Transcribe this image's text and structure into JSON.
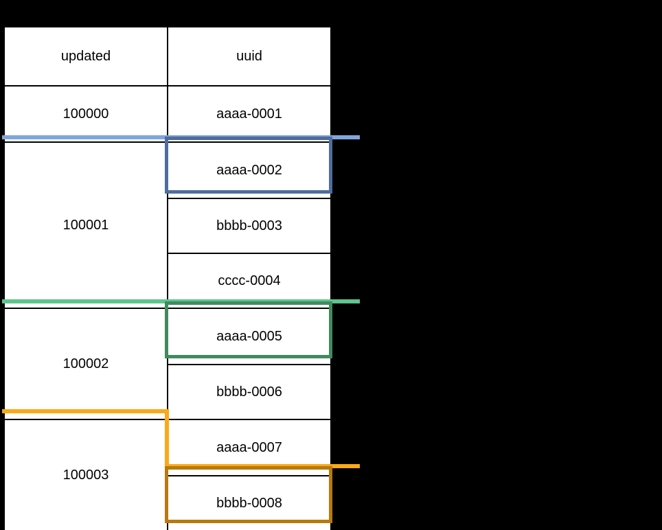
{
  "diagram": {
    "type": "table-grouping-illustration",
    "background_color": "#000000",
    "table": {
      "border_color": "#000000",
      "cell_background": "#ffffff",
      "text_color": "#000000",
      "columns": [
        "updated",
        "uuid"
      ],
      "header": {
        "updated": "updated",
        "uuid": "uuid"
      },
      "rows": [
        {
          "updated": "100000",
          "uuids": [
            "aaaa-0001"
          ]
        },
        {
          "updated": "100001",
          "uuids": [
            "aaaa-0002",
            "bbbb-0003",
            "cccc-0004"
          ]
        },
        {
          "updated": "100002",
          "uuids": [
            "aaaa-0005",
            "bbbb-0006"
          ]
        },
        {
          "updated": "100003",
          "uuids": [
            "aaaa-0007",
            "bbbb-0008"
          ]
        }
      ]
    },
    "markers": [
      {
        "name": "blue-group-marker",
        "line_color": "#7FA6DC",
        "box_color": "#4F6D9E",
        "boundary_after_row": "100000",
        "highlighted_uuid": "aaaa-0002"
      },
      {
        "name": "green-group-marker",
        "line_color": "#5DC58E",
        "box_color": "#428A5F",
        "boundary_after_row": "100001",
        "highlighted_uuid": "aaaa-0005"
      },
      {
        "name": "orange-group-marker",
        "line_color": "#FBA919",
        "box_color": "#B8790D",
        "boundary_after_row": "100002",
        "highlighted_uuid": "bbbb-0008"
      }
    ]
  }
}
